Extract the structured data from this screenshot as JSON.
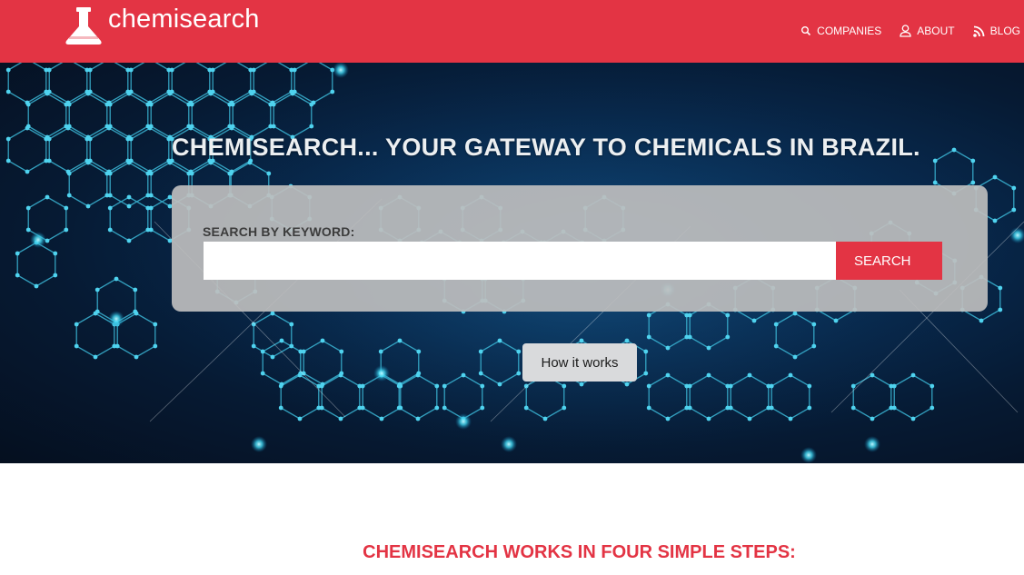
{
  "header": {
    "brand": "chemisearch",
    "logo_icon": "flask-icon",
    "nav": [
      {
        "label": "COMPANIES",
        "icon": "search-icon"
      },
      {
        "label": "ABOUT",
        "icon": "user-icon"
      },
      {
        "label": "BLOG",
        "icon": "rss-icon"
      }
    ],
    "color": "#e33444"
  },
  "hero": {
    "headline": "CHEMISEARCH... YOUR GATEWAY TO CHEMICALS IN BRAZIL.",
    "search": {
      "label": "SEARCH BY KEYWORD:",
      "value": "",
      "placeholder": "",
      "button_label": "SEARCH"
    },
    "how_button_label": "How it works",
    "background": "molecular-hexagon-network"
  },
  "steps": {
    "title": "CHEMISEARCH WORKS IN FOUR SIMPLE STEPS:"
  }
}
